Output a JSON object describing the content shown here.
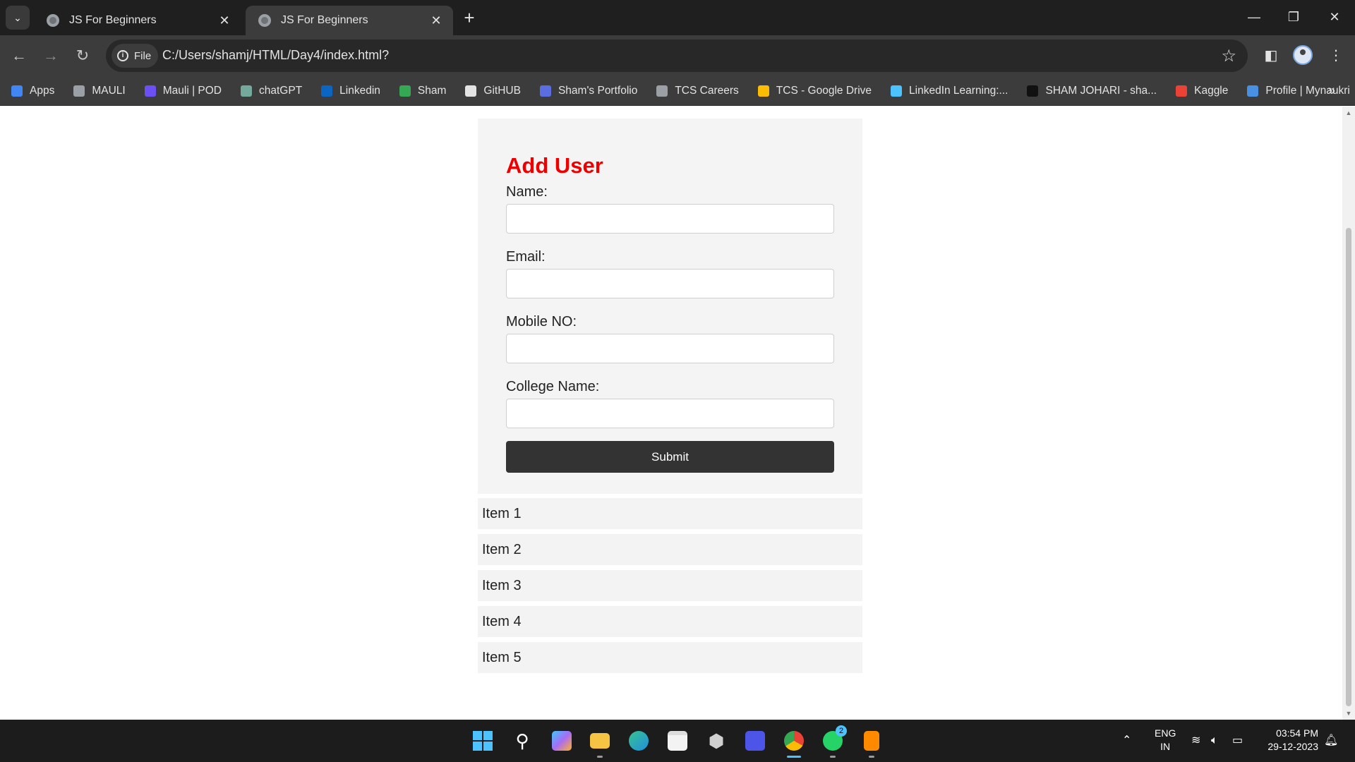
{
  "browser": {
    "tabs": [
      {
        "title": "JS For Beginners",
        "active": false
      },
      {
        "title": "JS For Beginners",
        "active": true
      }
    ],
    "new_tab_label": "+",
    "address": {
      "chip_label": "File",
      "url": "C:/Users/shamj/HTML/Day4/index.html?"
    },
    "bookmarks": [
      {
        "label": "Apps",
        "icon": "apps-grid-icon",
        "color": "#4285f4"
      },
      {
        "label": "MAULI",
        "icon": "globe-icon",
        "color": "#9aa0a6"
      },
      {
        "label": "Mauli | POD",
        "icon": "pod-icon",
        "color": "#6c4ff5"
      },
      {
        "label": "chatGPT",
        "icon": "openai-icon",
        "color": "#74aa9c"
      },
      {
        "label": "Linkedin",
        "icon": "linkedin-icon",
        "color": "#0a66c2"
      },
      {
        "label": "Sham",
        "icon": "google-drive-icon",
        "color": "#34a853"
      },
      {
        "label": "GitHUB",
        "icon": "github-icon",
        "color": "#e3e3e3"
      },
      {
        "label": "Sham's Portfolio",
        "icon": "portfolio-icon",
        "color": "#5b6ee1"
      },
      {
        "label": "TCS Careers",
        "icon": "globe-icon",
        "color": "#9aa0a6"
      },
      {
        "label": "TCS - Google Drive",
        "icon": "google-drive-icon",
        "color": "#fbbc04"
      },
      {
        "label": "LinkedIn Learning:...",
        "icon": "linkedin-learning-icon",
        "color": "#4cc2ff"
      },
      {
        "label": "SHAM JOHARI - sha...",
        "icon": "hackerrank-icon",
        "color": "#111111"
      },
      {
        "label": "Kaggle",
        "icon": "google-icon",
        "color": "#ea4335"
      },
      {
        "label": "Profile | Mynaukri",
        "icon": "naukri-icon",
        "color": "#4a90e2"
      }
    ]
  },
  "form": {
    "title": "Add User",
    "fields": [
      {
        "label": "Name:",
        "value": ""
      },
      {
        "label": "Email:",
        "value": ""
      },
      {
        "label": "Mobile NO:",
        "value": ""
      },
      {
        "label": "College Name:",
        "value": ""
      }
    ],
    "submit_label": "Submit"
  },
  "items": [
    "Item 1",
    "Item 2",
    "Item 3",
    "Item 4",
    "Item 5"
  ],
  "taskbar": {
    "language": "ENG",
    "region": "IN",
    "time": "03:54 PM",
    "date": "29-12-2023",
    "whatsapp_badge": "2"
  },
  "colors": {
    "accent_title": "#ee0000",
    "submit_bg": "#333333",
    "card_bg": "#f4f4f4"
  }
}
